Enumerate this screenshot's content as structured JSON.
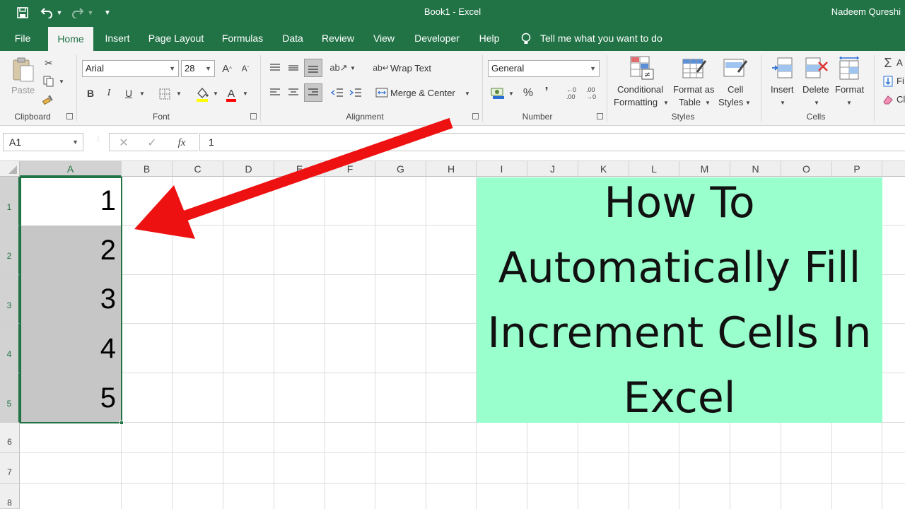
{
  "titlebar": {
    "title": "Book1  -  Excel",
    "user": "Nadeem Qureshi"
  },
  "tabs": [
    "File",
    "Home",
    "Insert",
    "Page Layout",
    "Formulas",
    "Data",
    "Review",
    "View",
    "Developer",
    "Help"
  ],
  "active_tab": "Home",
  "tell_me": "Tell me what you want to do",
  "ribbon": {
    "clipboard": {
      "paste": "Paste",
      "label": "Clipboard"
    },
    "font": {
      "name": "Arial",
      "size": "28",
      "bold": "B",
      "italic": "I",
      "underline": "U",
      "label": "Font"
    },
    "alignment": {
      "wrap": "Wrap Text",
      "merge": "Merge & Center",
      "label": "Alignment"
    },
    "number": {
      "format": "General",
      "label": "Number",
      "percent": "%",
      "comma": "’"
    },
    "styles": {
      "conditional_1": "Conditional",
      "conditional_2": "Formatting",
      "format_table_1": "Format as",
      "format_table_2": "Table",
      "cell_styles_1": "Cell",
      "cell_styles_2": "Styles",
      "label": "Styles"
    },
    "cells": {
      "insert": "Insert",
      "delete": "Delete",
      "format": "Format",
      "label": "Cells"
    },
    "editing": {
      "a": "A",
      "f": "Fi",
      "c": "Cl"
    }
  },
  "formula_bar": {
    "name_box": "A1",
    "fx": "fx",
    "value": "1"
  },
  "columns": [
    "A",
    "B",
    "C",
    "D",
    "E",
    "F",
    "G",
    "H",
    "I",
    "J",
    "K",
    "L",
    "M",
    "N",
    "O",
    "P"
  ],
  "rows": [
    "1",
    "2",
    "3",
    "4",
    "5",
    "6",
    "7",
    "8"
  ],
  "cells_a": [
    "1",
    "2",
    "3",
    "4",
    "5"
  ],
  "title_text": "How To Automatically Fill Increment Cells In Excel",
  "colors": {
    "excel_green": "#217346",
    "title_fill": "#99ffcc",
    "arrow": "#ee1111",
    "selection": "#c6c6c6"
  }
}
